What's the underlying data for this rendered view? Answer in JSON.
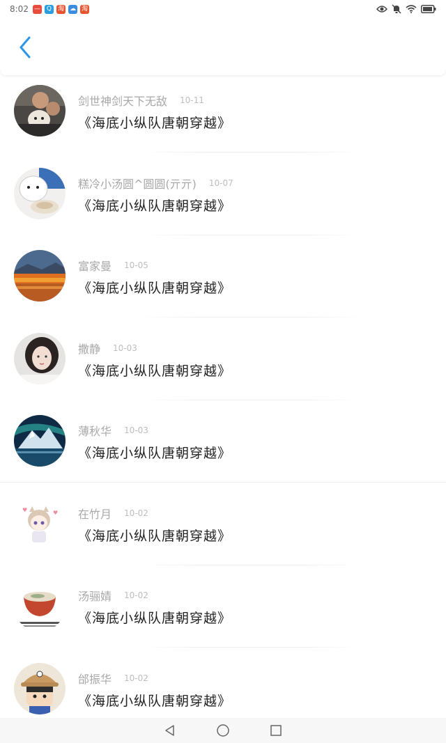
{
  "status_bar": {
    "time": "8:02",
    "app_badges": [
      {
        "name": "red-app-badge",
        "text": "—",
        "color": "#e84a3c"
      },
      {
        "name": "blue-app-badge",
        "text": "Q",
        "color": "#2a9de0"
      },
      {
        "name": "taobao-badge-1",
        "text": "淘",
        "color": "#e8542e"
      },
      {
        "name": "cloud-badge",
        "text": "☁",
        "color": "#3b8de0"
      },
      {
        "name": "taobao-badge-2",
        "text": "淘",
        "color": "#e8542e"
      }
    ]
  },
  "header": {
    "back_icon": "chevron-left-icon",
    "accent": "#2c95e8"
  },
  "comments": [
    {
      "name": "剑世神剑天下无敌",
      "date": "10-11",
      "text": "《海底小纵队唐朝穿越》",
      "avatar": "people-with-dog"
    },
    {
      "name": "糕冷小汤圆^圆圆(亓亓)",
      "date": "10-07",
      "text": "《海底小纵队唐朝穿越》",
      "avatar": "cartoon-cat"
    },
    {
      "name": "富家曼",
      "date": "10-05",
      "text": "《海底小纵队唐朝穿越》",
      "avatar": "autumn-landscape"
    },
    {
      "name": "撒静",
      "date": "10-03",
      "text": "《海底小纵队唐朝穿越》",
      "avatar": "girl-portrait"
    },
    {
      "name": "薄秋华",
      "date": "10-03",
      "text": "《海底小纵队唐朝穿越》",
      "avatar": "aurora-mountain"
    },
    {
      "name": "在竹月",
      "date": "10-02",
      "text": "《海底小纵队唐朝穿越》",
      "avatar": "anime-character"
    },
    {
      "name": "汤骊婧",
      "date": "10-02",
      "text": "《海底小纵队唐朝穿越》",
      "avatar": "noodle-bowl"
    },
    {
      "name": "邰振华",
      "date": "10-02",
      "text": "《海底小纵队唐朝穿越》",
      "avatar": "cartoon-boy"
    }
  ],
  "nav_bar": {
    "icons": [
      "back-triangle-icon",
      "home-circle-icon",
      "recents-square-icon"
    ]
  }
}
